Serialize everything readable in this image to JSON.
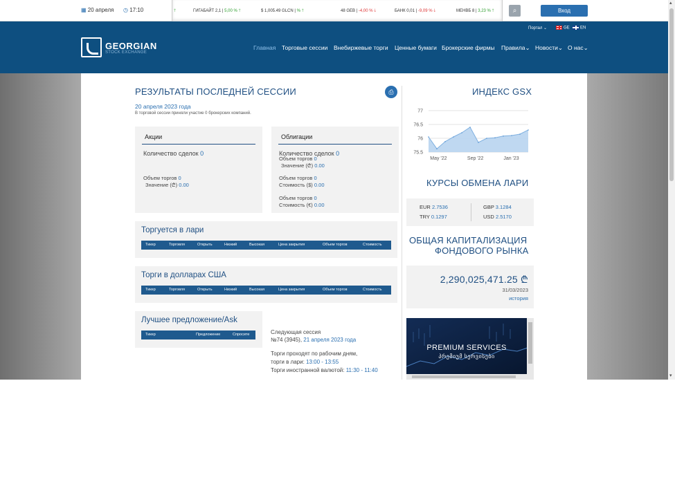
{
  "topbar": {
    "date": "20 апреля",
    "time": "17:10",
    "login": "Вход"
  },
  "ticker": [
    {
      "name": "ГИГАБАЙТ 2,1 |",
      "change": "5,00 %",
      "dir": "up"
    },
    {
      "name": "$ 1,005.49 GLCN |",
      "change": "%",
      "dir": "up"
    },
    {
      "name": "48 GEB |",
      "change": "-4,00 %",
      "dir": "down"
    },
    {
      "name": "БАНК 0,01 |",
      "change": "-9,09 %",
      "dir": "down"
    },
    {
      "name": "МЕНВБ 8 |",
      "change": "3,23 %",
      "dir": "up"
    }
  ],
  "header": {
    "logo_main": "GEORGIAN",
    "logo_sub": "STOCK EXCHANGE",
    "portal": "Портал",
    "lang_ge": "GE",
    "lang_en": "EN",
    "nav": [
      "Главная",
      "Торговые сессии",
      "Внебиржевые торги",
      "Ценные бумаги",
      "Брокерские фирмы",
      "Правила",
      "Новости",
      "О нас"
    ]
  },
  "session": {
    "title": "РЕЗУЛЬТАТЫ ПОСЛЕДНЕЙ СЕССИИ",
    "date": "20 апреля 2023 года",
    "note": "В торговой сессии приняли участие 0 брокерских компаний.",
    "stocks": {
      "title": "Акции",
      "deals_label": "Количество сделок",
      "deals": "0",
      "volume_label": "Объем торгов",
      "volume": "0",
      "value_label": "Значение (₾)",
      "value": "0.00"
    },
    "bonds": {
      "title": "Облигации",
      "deals_label": "Количество сделок",
      "deals": "0",
      "rows": [
        {
          "volume_label": "Объем торгов",
          "volume": "0",
          "value_label": "Значение (₾)",
          "value": "0.00"
        },
        {
          "volume_label": "Объем торгов",
          "volume": "0",
          "value_label": "Стоимость ($)",
          "value": "0.00"
        },
        {
          "volume_label": "Объем торгов",
          "volume": "0",
          "value_label": "Стоимость (€)",
          "value": "0.00"
        }
      ]
    }
  },
  "gel_table": {
    "title": "Торгуется в лари",
    "columns": [
      "Тикер",
      "Торговля",
      "Открыть",
      "Низкий",
      "Высокая",
      "Цена закрытия",
      "Объем торгов",
      "Стоимость"
    ]
  },
  "usd_table": {
    "title": "Торги в долларах США",
    "columns": [
      "Тикер",
      "Торговля",
      "Открыть",
      "Низкий",
      "Высокая",
      "Цена закрытия",
      "Объем торгов",
      "Стоимость"
    ]
  },
  "ask_table": {
    "title": "Лучшее предложение/Ask",
    "columns": [
      "Тикер",
      "Предложение",
      "Спросите"
    ]
  },
  "next": {
    "label": "Следующая сессия",
    "number": "№74 (3945),",
    "date": "21 апреля 2023 года",
    "line1": "Торги проходят по рабочим дням,",
    "line2_label": "торги в лари:",
    "line2": "13:00 - 13:55",
    "line3_label": "Торги иностранной валютой:",
    "line3": "11:30 - 11:40"
  },
  "index": {
    "title": "ИНДЕКС GSX"
  },
  "chart_data": {
    "type": "area",
    "title": "ИНДЕКС GSX",
    "y_ticks": [
      "77",
      "76.5",
      "76",
      "75.5"
    ],
    "x_ticks": [
      "May '22",
      "Sep '22",
      "Jan '23"
    ],
    "ylim": [
      75.5,
      77
    ],
    "grid": true,
    "x": [
      "2022-04",
      "2022-05",
      "2022-06",
      "2022-07",
      "2022-08",
      "2022-09",
      "2022-10",
      "2022-11",
      "2022-12",
      "2023-01",
      "2023-02",
      "2023-03",
      "2023-04"
    ],
    "values": [
      76.05,
      75.62,
      75.88,
      76.05,
      76.2,
      76.4,
      75.85,
      76.0,
      76.02,
      76.08,
      76.1,
      76.15,
      76.3
    ]
  },
  "rates": {
    "title": "КУРСЫ ОБМЕНА ЛАРИ",
    "items": [
      {
        "cur": "EUR",
        "val": "2.7536"
      },
      {
        "cur": "GBP",
        "val": "3.1284"
      },
      {
        "cur": "TRY",
        "val": "0.1297"
      },
      {
        "cur": "USD",
        "val": "2.5170"
      }
    ]
  },
  "cap": {
    "title1": "ОБЩАЯ КАПИТАЛИЗАЦИЯ",
    "title2": "ФОНДОВОГО РЫНКА",
    "value": "2,290,025,471.25 ₾",
    "date": "31/03/2023",
    "history": "история"
  },
  "banner": {
    "line1": "PREMIUM SERVICES",
    "line2": "პრემიუმ სერვისები"
  }
}
